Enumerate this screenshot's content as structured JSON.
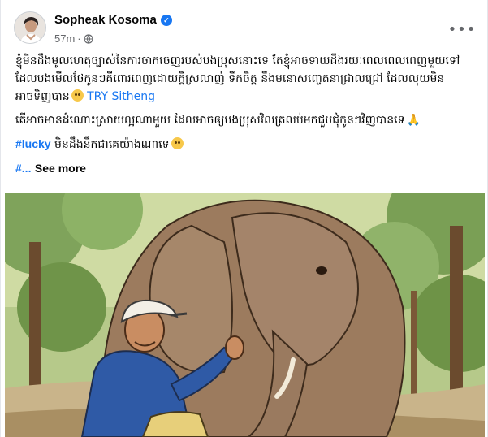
{
  "post": {
    "author": "Sopheak Kosoma",
    "verified": true,
    "time": "57m",
    "audience_icon": "globe-icon",
    "more_icon": "ellipsis-icon",
    "paragraphs": [
      {
        "text": "ខ្ញុំមិនដឹងមូលហេតុច្បាស់នៃការចាកចេញរបស់បងប្រុសនោះទេ តែខ្ញុំអាចទាយដឹងរយៈពេលពេលពេញមួយទៅដែលបងមើលថែកូនៗគឺពោរពេញដោយក្តីស្រលាញ់ ទឹកចិត្ត នឹងមនោសញ្ចេតនាជ្រាលជ្រៅ ដែលលុយមិនអាចទិញបាន",
        "mention": "TRY Sitheng"
      },
      {
        "text": "តើអាចមានដំណោះស្រាយល្អណាមួយ ដែលអាចឲ្យបងប្រុសវិលត្រលប់មកជួបជុំកូនៗវិញបានទេ"
      },
      {
        "hashtag": "#lucky",
        "text": " មិនដឹងនឹកជាគេយ៉ាងណាទេ"
      }
    ],
    "truncated_prefix": "#...",
    "see_more": "See more"
  },
  "colors": {
    "link": "#1877f2",
    "meta": "#65676b",
    "text": "#050505"
  }
}
